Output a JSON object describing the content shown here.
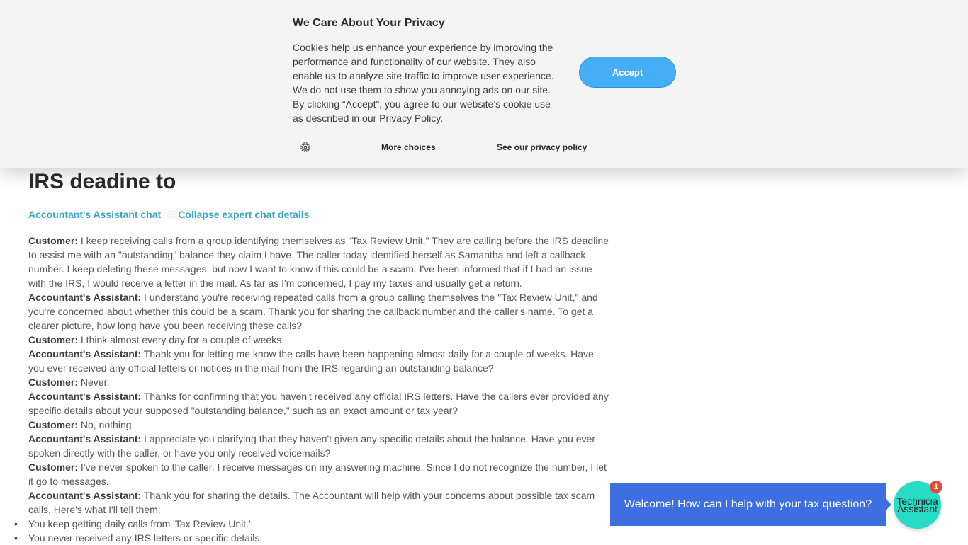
{
  "cookie_banner": {
    "title": "We Care About Your Privacy",
    "text": "Cookies help us enhance your experience by improving the performance and functionality of our website. They also enable us to analyze site traffic to improve user experience. We do not use them to show you annoying ads on our site. By clicking “Accept”, you agree to our website’s cookie use as described in our Privacy Policy.",
    "accept_label": "Accept",
    "more_choices_label": "More choices",
    "privacy_link_label": "See our privacy policy",
    "settings_icon": "gear-icon"
  },
  "page": {
    "title": "IRS deadine to",
    "chat_link": "Accountant's Assistant chat",
    "collapse_label": "Collapse expert chat details"
  },
  "transcript": [
    {
      "speaker": "Customer:",
      "text": " I keep receiving calls from a group identifying themselves as \"Tax Review Unit.\" They are calling before the IRS deadline to assist me with an \"outstanding\" balance they claim I have. The caller today identified herself as Samantha and left a callback number. I keep deleting these messages, but now I want to know if this could be a scam. I've been informed that if I had an issue with the IRS, I would receive a letter in the mail. As far as I'm concerned, I pay my taxes and usually get a return."
    },
    {
      "speaker": "Accountant's Assistant:",
      "text": " I understand you're receiving repeated calls from a group calling themselves the \"Tax Review Unit,\" and you're concerned about whether this could be a scam. Thank you for sharing the callback number and the caller's name. To get a clearer picture, how long have you been receiving these calls?"
    },
    {
      "speaker": "Customer:",
      "text": " I think almost every day for a couple of weeks."
    },
    {
      "speaker": "Accountant's Assistant:",
      "text": " Thank you for letting me know the calls have been happening almost daily for a couple of weeks. Have you ever received any official letters or notices in the mail from the IRS regarding an outstanding balance?"
    },
    {
      "speaker": "Customer:",
      "text": " Never."
    },
    {
      "speaker": "Accountant's Assistant:",
      "text": " Thanks for confirming that you haven't received any official IRS letters. Have the callers ever provided any specific details about your supposed \"outstanding balance,\" such as an exact amount or tax year?"
    },
    {
      "speaker": "Customer:",
      "text": " No, nothing."
    },
    {
      "speaker": "Accountant's Assistant:",
      "text": " I appreciate you clarifying that they haven't given any specific details about the balance. Have you ever spoken directly with the caller, or have you only received voicemails?"
    },
    {
      "speaker": "Customer:",
      "text": " I've never spoken to the caller. I receive messages on my answering machine. Since I do not recognize the number, I let it go to messages."
    },
    {
      "speaker": "Accountant's Assistant:",
      "text": " Thank you for sharing the details. The Accountant will help with your concerns about possible tax scam calls. Here's what I'll tell them:"
    }
  ],
  "summary": [
    "You keep getting daily calls from 'Tax Review Unit.'",
    "You never received any IRS letters or specific details."
  ],
  "chat_widget": {
    "welcome": "Welcome! How can I help with your tax question?",
    "avatar_line1": "Technicia",
    "avatar_line2": "Assistant",
    "badge_count": "1"
  },
  "colors": {
    "accept": "#46aef7",
    "link": "#3ba7c8",
    "welcome_bg": "#3f6ee0",
    "avatar_bg": "#27dcc6",
    "badge": "#e24c3c"
  }
}
